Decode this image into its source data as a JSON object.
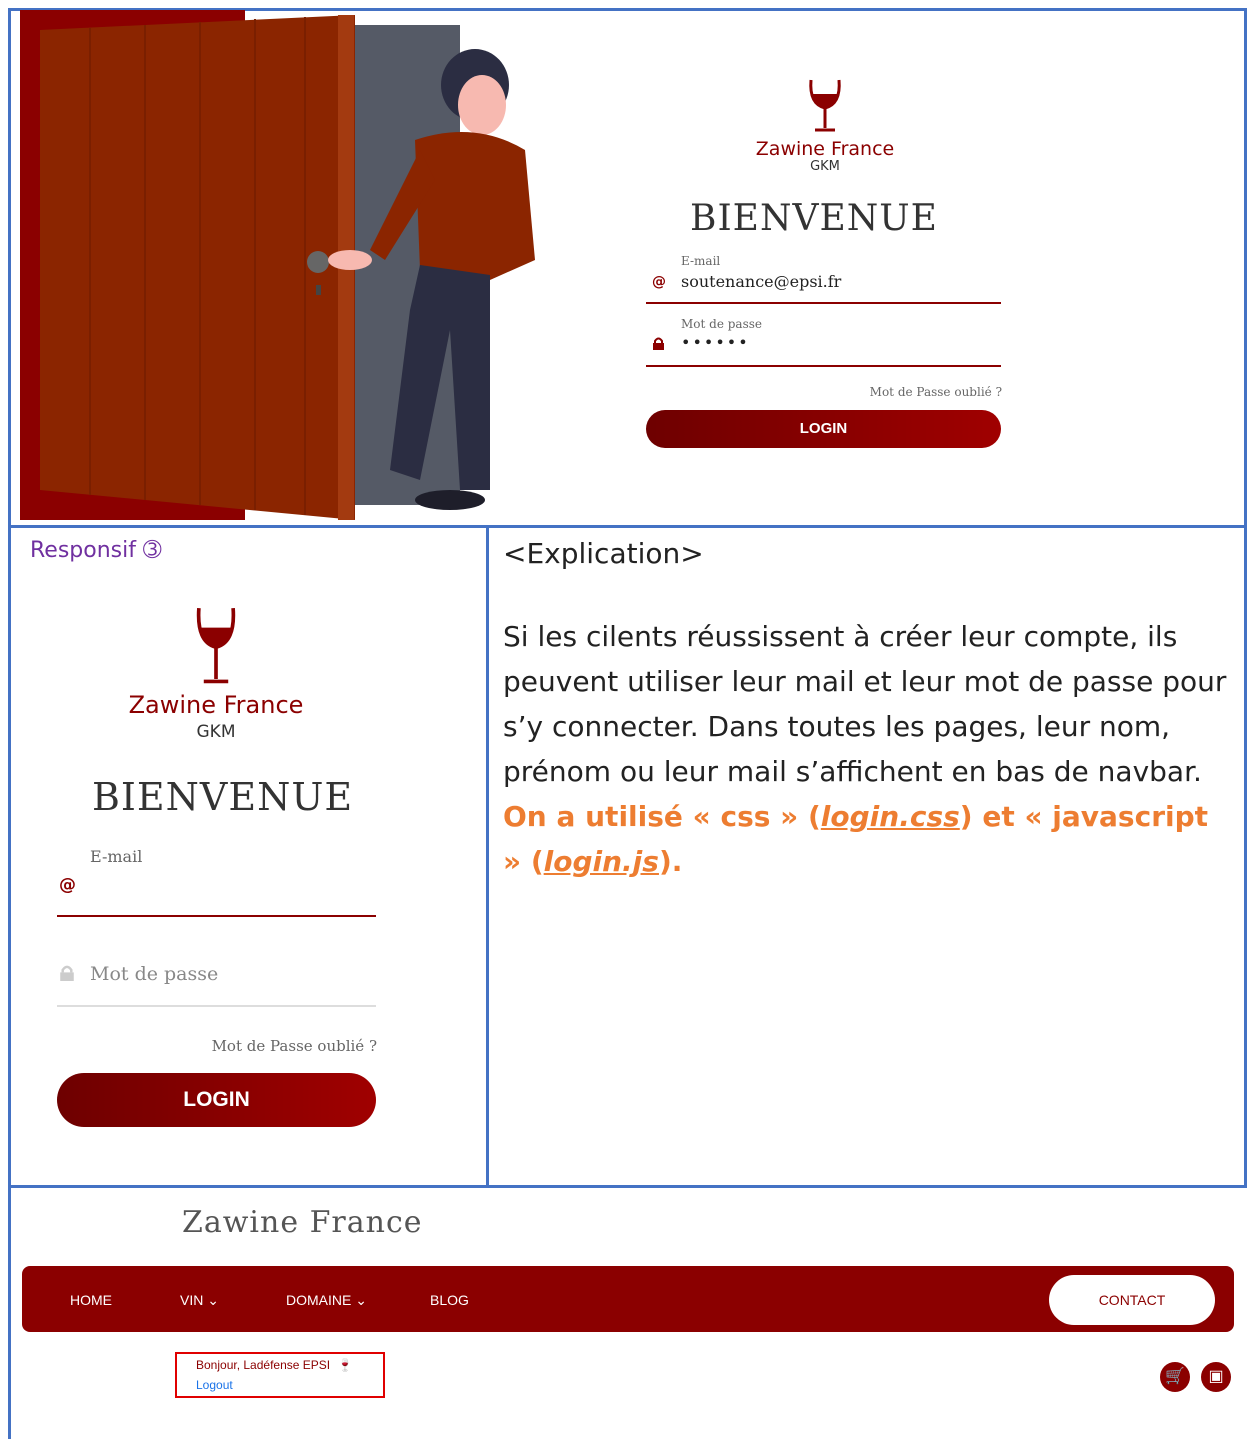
{
  "desktop": {
    "brand": "Zawine France",
    "brand_sub": "GKM",
    "welcome": "BIENVENUE",
    "email_label": "E-mail",
    "email_value": "soutenance@epsi.fr",
    "password_label": "Mot de passe",
    "password_value": "••••••",
    "forgot": "Mot de Passe oublié ?",
    "login": "LOGIN"
  },
  "responsive": {
    "caption": "Responsif ➂",
    "brand": "Zawine France",
    "brand_sub": "GKM",
    "welcome": "BIENVENUE",
    "email_label": "E-mail",
    "email_icon": "@",
    "password_placeholder": "Mot de passe",
    "forgot": "Mot de Passe oublié ?",
    "login": "LOGIN"
  },
  "explanation": {
    "title": "<Explication>",
    "body": " Si les cilents réussissent à créer leur compte, ils peuvent utiliser leur mail et leur mot de passe pour s’y connecter. Dans toutes les pages, leur nom, prénom ou leur mail s’affichent en bas de navbar.",
    "orange_1": "On a utilisé  « css » (",
    "file_1": "login.css",
    "orange_2": ") et « javascript » (",
    "file_2": "login.js",
    "orange_3": ")."
  },
  "site": {
    "title": "Zawine France",
    "nav": [
      "HOME",
      "VIN ⌄",
      "DOMAINE ⌄",
      "BLOG"
    ],
    "contact": "CONTACT",
    "greeting": "Bonjour, Ladéfense EPSI",
    "logout": "Logout"
  },
  "colors": {
    "brand_red": "#8b0000",
    "accent_orange": "#ed7d31",
    "table_border": "#4472c4",
    "caption_purple": "#7030a0"
  },
  "icons": [
    "wine-glass-icon",
    "at-icon",
    "lock-icon",
    "cart-icon",
    "register-icon",
    "chevron-down-icon"
  ]
}
